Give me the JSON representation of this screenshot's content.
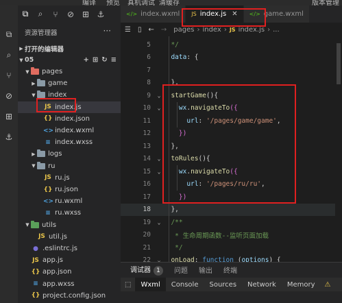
{
  "menubar": {
    "items": [
      "编译",
      "预览",
      "真机调试",
      "清缓存",
      "版本管理"
    ]
  },
  "activity_icons": [
    "files-icon",
    "search-icon",
    "source-control-icon",
    "debug-icon",
    "extensions-icon",
    "docker-icon"
  ],
  "sidebar": {
    "top_icons": [
      "copy-icon",
      "search-icon",
      "branch-icon",
      "bug-icon",
      "grid-icon",
      "docker-icon"
    ],
    "header": "资源管理器",
    "more": "···",
    "open_editors": "打开的编辑器",
    "project": "05",
    "tree": [
      {
        "depth": 1,
        "type": "folder",
        "open": true,
        "label": "pages",
        "color": "#e06c60"
      },
      {
        "depth": 2,
        "type": "folder",
        "open": false,
        "label": "game",
        "color": "#8a9aa6"
      },
      {
        "depth": 2,
        "type": "folder",
        "open": true,
        "label": "index",
        "color": "#8a9aa6"
      },
      {
        "depth": 3,
        "type": "js",
        "label": "index.js",
        "selected": true
      },
      {
        "depth": 3,
        "type": "json",
        "label": "index.json"
      },
      {
        "depth": 3,
        "type": "wxml",
        "label": "index.wxml"
      },
      {
        "depth": 3,
        "type": "wxss",
        "label": "index.wxss"
      },
      {
        "depth": 2,
        "type": "folder",
        "open": false,
        "label": "logs",
        "color": "#8a9aa6"
      },
      {
        "depth": 2,
        "type": "folder",
        "open": true,
        "label": "ru",
        "color": "#8a9aa6"
      },
      {
        "depth": 3,
        "type": "js",
        "label": "ru.js"
      },
      {
        "depth": 3,
        "type": "json",
        "label": "ru.json"
      },
      {
        "depth": 3,
        "type": "wxml",
        "label": "ru.wxml"
      },
      {
        "depth": 3,
        "type": "wxss",
        "label": "ru.wxss"
      },
      {
        "depth": 1,
        "type": "folder",
        "open": true,
        "label": "utils",
        "color": "#5aa05a"
      },
      {
        "depth": 2,
        "type": "js",
        "label": "util.js"
      },
      {
        "depth": 1,
        "type": "eslint",
        "label": ".eslintrc.js"
      },
      {
        "depth": 1,
        "type": "js",
        "label": "app.js"
      },
      {
        "depth": 1,
        "type": "json",
        "label": "app.json"
      },
      {
        "depth": 1,
        "type": "wxss",
        "label": "app.wxss"
      },
      {
        "depth": 1,
        "type": "json",
        "label": "project.config.json"
      }
    ]
  },
  "tabs": [
    {
      "label": "index.wxml",
      "icon": "wxml",
      "active": false
    },
    {
      "label": "index.js",
      "icon": "js",
      "active": true,
      "close": "✕"
    },
    {
      "label": "game.wxml",
      "icon": "wxml",
      "active": false
    }
  ],
  "breadcrumb": {
    "parts": [
      "pages",
      "index",
      "index.js"
    ],
    "tail": "..."
  },
  "code": {
    "lines": [
      {
        "n": "5",
        "tokens": [
          [
            "com",
            "  */"
          ]
        ]
      },
      {
        "n": "6",
        "tokens": [
          [
            "prop",
            "  data"
          ],
          [
            "pun",
            ": {"
          ]
        ]
      },
      {
        "n": "7",
        "tokens": []
      },
      {
        "n": "8",
        "tokens": [
          [
            "pun",
            "  },"
          ]
        ]
      },
      {
        "n": "9",
        "fold": true,
        "tokens": [
          [
            "fn",
            "  startGame"
          ],
          [
            "pun",
            "(){"
          ]
        ]
      },
      {
        "n": "10",
        "fold": true,
        "tokens": [
          [
            "prop",
            "    wx"
          ],
          [
            "pun",
            "."
          ],
          [
            "fn",
            "navigateTo"
          ],
          [
            "brk",
            "({"
          ]
        ]
      },
      {
        "n": "11",
        "tokens": [
          [
            "prop",
            "      url"
          ],
          [
            "pun",
            ": "
          ],
          [
            "str",
            "'/pages/game/game'"
          ],
          [
            "pun",
            ","
          ]
        ]
      },
      {
        "n": "12",
        "tokens": [
          [
            "brk",
            "    })"
          ]
        ]
      },
      {
        "n": "13",
        "tokens": [
          [
            "pun",
            "  },"
          ]
        ]
      },
      {
        "n": "14",
        "fold": true,
        "tokens": [
          [
            "fn",
            "  toRules"
          ],
          [
            "pun",
            "(){"
          ]
        ]
      },
      {
        "n": "15",
        "fold": true,
        "tokens": [
          [
            "prop",
            "    wx"
          ],
          [
            "pun",
            "."
          ],
          [
            "fn",
            "navigateTo"
          ],
          [
            "brk",
            "({"
          ]
        ]
      },
      {
        "n": "16",
        "tokens": [
          [
            "prop",
            "      url"
          ],
          [
            "pun",
            ": "
          ],
          [
            "str",
            "'/pages/ru/ru'"
          ],
          [
            "pun",
            ","
          ]
        ]
      },
      {
        "n": "17",
        "tokens": [
          [
            "brk",
            "    })"
          ]
        ]
      },
      {
        "n": "18",
        "current": true,
        "tokens": [
          [
            "pun",
            "  },"
          ]
        ]
      },
      {
        "n": "19",
        "fold": true,
        "tokens": [
          [
            "com",
            "  /**"
          ]
        ]
      },
      {
        "n": "20",
        "tokens": [
          [
            "com",
            "   * 生命周期函数--监听页面加载"
          ]
        ]
      },
      {
        "n": "21",
        "tokens": [
          [
            "com",
            "   */"
          ]
        ]
      },
      {
        "n": "22",
        "fold": true,
        "tokens": [
          [
            "fn",
            "  onLoad"
          ],
          [
            "pun",
            ": "
          ],
          [
            "kw",
            "function"
          ],
          [
            "pun",
            " ("
          ],
          [
            "prop",
            "options"
          ],
          [
            "pun",
            ") {"
          ]
        ]
      }
    ]
  },
  "panel": {
    "tabs": [
      "调试器",
      "问题",
      "输出",
      "终端"
    ],
    "badge": "1",
    "devtools": [
      "Wxml",
      "Console",
      "Sources",
      "Network",
      "Memory"
    ],
    "inspect_icon": "inspect-icon",
    "warning_icon": "warning-icon"
  },
  "colors": {
    "highlight_red": "#e02020",
    "js_icon": "#e8c44a",
    "json_icon": "#e8c44a",
    "wxml_icon": "#4fa3e0",
    "wxss_icon": "#4fa3e0",
    "wxml_tab_icon": "#52c41a"
  }
}
